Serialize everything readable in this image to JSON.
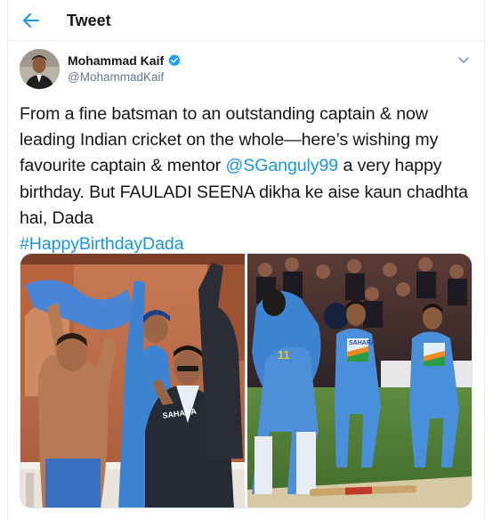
{
  "topbar": {
    "title": "Tweet",
    "back_icon": "back-arrow-icon"
  },
  "author": {
    "display_name": "Mohammad Kaif",
    "handle": "@MohammadKaif",
    "verified_icon": "verified-badge-icon",
    "menu_icon": "chevron-down-icon"
  },
  "tweet": {
    "text_part1": "From a fine batsman to an outstanding captain & now leading Indian cricket on the whole—here’s wishing my favourite captain & mentor ",
    "mention": "@SGanguly99",
    "text_part2": " a very happy birthday. But FAULADI SEENA dikha ke aise kaun chadhta hai, Dada",
    "hashtag": "#HappyBirthdayDada"
  },
  "media": {
    "photo_left_jersey_text": "SAHARA",
    "photo_right_jersey_text": "SAHARA",
    "player_number": "11"
  },
  "colors": {
    "accent": "#1b95e0",
    "text": "#14171a",
    "muted": "#657786",
    "jersey": "#3f8fd6"
  }
}
